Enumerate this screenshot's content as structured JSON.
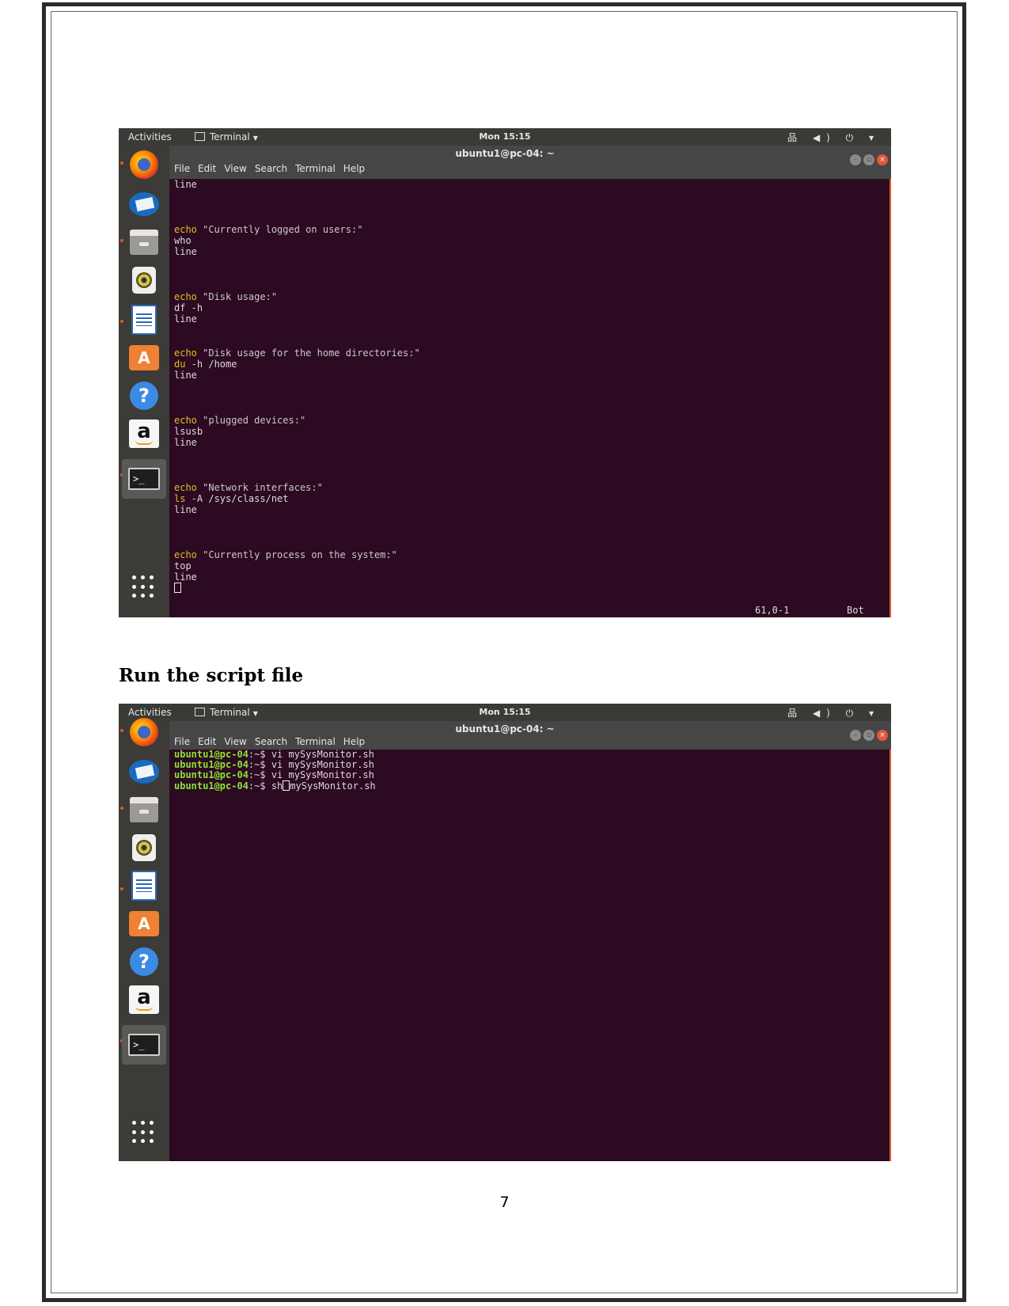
{
  "topbar": {
    "activities": "Activities",
    "app_menu": "Terminal",
    "clock": "Mon 15:15",
    "status_icons": "品 ◀) ⏻ ▾"
  },
  "window": {
    "title": "ubuntu1@pc-04: ~",
    "menu": [
      "File",
      "Edit",
      "View",
      "Search",
      "Terminal",
      "Help"
    ]
  },
  "screenshot1": {
    "lines": [
      {
        "cmd": "line",
        "arg": ""
      },
      {
        "cmd": "echo",
        "arg": " \"Currently logged on users:\""
      },
      {
        "cmd": "who",
        "arg": ""
      },
      {
        "cmd": "line",
        "arg": ""
      },
      {
        "cmd": "echo",
        "arg": " \"Disk usage:\""
      },
      {
        "cmd": "df",
        "arg": " -h"
      },
      {
        "cmd": "line",
        "arg": ""
      },
      {
        "cmd": "echo",
        "arg": " \"Disk usage for the home directories:\""
      },
      {
        "cmd": "du",
        "arg": " -h /home"
      },
      {
        "cmd": "line",
        "arg": ""
      },
      {
        "cmd": "echo",
        "arg": " \"plugged devices:\""
      },
      {
        "cmd": "lsusb",
        "arg": ""
      },
      {
        "cmd": "line",
        "arg": ""
      },
      {
        "cmd": "echo",
        "arg": " \"Network interfaces:\""
      },
      {
        "cmd": "ls",
        "arg": " -A /sys/class/net"
      },
      {
        "cmd": "line",
        "arg": ""
      },
      {
        "cmd": "echo",
        "arg": " \"Currently process on the system:\""
      },
      {
        "cmd": "top",
        "arg": ""
      },
      {
        "cmd": "line",
        "arg": ""
      }
    ],
    "status_position": "61,0-1",
    "status_scroll": "Bot"
  },
  "heading": "Run the script file",
  "screenshot2": {
    "prompt": "ubuntu1@pc-04",
    "prompt_suffix": ":~$ ",
    "commands": [
      "vi mySysMonitor.sh",
      "vi mySysMonitor.sh",
      "vi mySysMonitor.sh"
    ],
    "current_before_cursor": "sh",
    "current_after_cursor": "mySysMonitor.sh"
  },
  "page_number": "7",
  "colors": {
    "terminal_bg": "#2c0a22",
    "prompt": "#8ae234",
    "keyword": "#e0c01c",
    "accent": "#e95420"
  },
  "dock_icons": [
    "firefox-icon",
    "thunderbird-icon",
    "files-icon",
    "rhythmbox-icon",
    "writer-icon",
    "software-icon",
    "help-icon",
    "amazon-icon",
    "terminal-icon",
    "show-apps-icon"
  ]
}
